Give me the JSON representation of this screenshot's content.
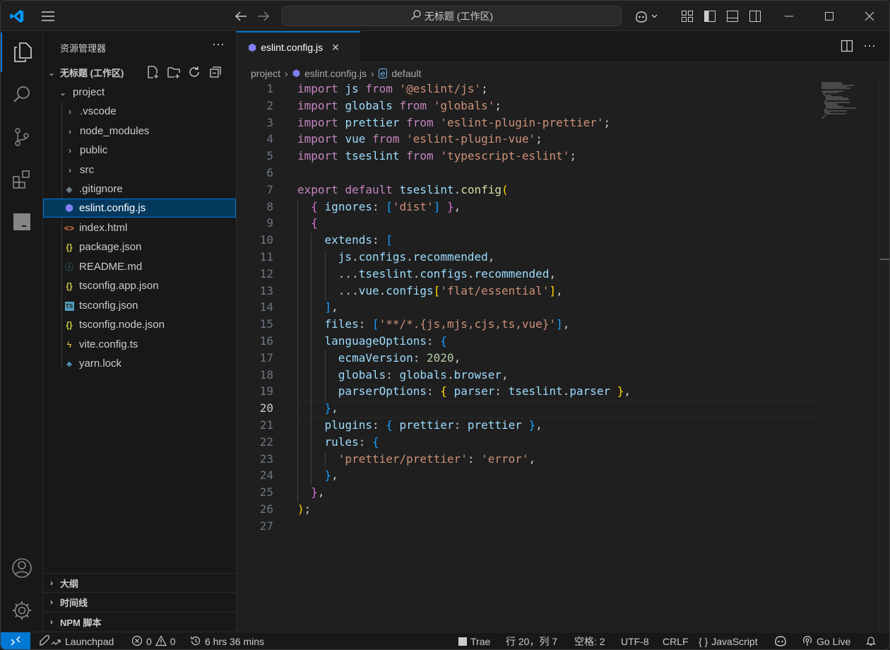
{
  "title_bar": {
    "search_text": "无标题 (工作区)"
  },
  "sidebar": {
    "header": "资源管理器",
    "workspace": "无标题 (工作区)",
    "tree": [
      {
        "label": "project",
        "icon": "chevron-down",
        "kind": "folder-open"
      },
      {
        "label": ".vscode",
        "icon": "chevron-right",
        "kind": "folder"
      },
      {
        "label": "node_modules",
        "icon": "chevron-right",
        "kind": "folder"
      },
      {
        "label": "public",
        "icon": "chevron-right",
        "kind": "folder"
      },
      {
        "label": "src",
        "icon": "chevron-right",
        "kind": "folder"
      },
      {
        "label": ".gitignore",
        "icon": "git-file-icon",
        "kind": "file"
      },
      {
        "label": "eslint.config.js",
        "icon": "eslint-file-icon",
        "kind": "file",
        "selected": true
      },
      {
        "label": "index.html",
        "icon": "html-file-icon",
        "kind": "file"
      },
      {
        "label": "package.json",
        "icon": "json-file-icon",
        "kind": "file"
      },
      {
        "label": "README.md",
        "icon": "info-file-icon",
        "kind": "file"
      },
      {
        "label": "tsconfig.app.json",
        "icon": "json-file-icon",
        "kind": "file"
      },
      {
        "label": "tsconfig.json",
        "icon": "ts-file-icon",
        "kind": "file"
      },
      {
        "label": "tsconfig.node.json",
        "icon": "json-file-icon",
        "kind": "file"
      },
      {
        "label": "vite.config.ts",
        "icon": "vite-file-icon",
        "kind": "file"
      },
      {
        "label": "yarn.lock",
        "icon": "yarn-file-icon",
        "kind": "file"
      }
    ],
    "panels": [
      "大纲",
      "时间线",
      "NPM 脚本"
    ]
  },
  "editor": {
    "tab_label": "eslint.config.js",
    "breadcrumb": [
      "project",
      "eslint.config.js",
      "default"
    ],
    "current_line": 20,
    "lines": [
      [
        [
          "kw",
          "import"
        ],
        [
          "p",
          " "
        ],
        [
          "id",
          "js"
        ],
        [
          "p",
          " "
        ],
        [
          "kw",
          "from"
        ],
        [
          "p",
          " "
        ],
        [
          "str",
          "'@eslint/js'"
        ],
        [
          "p",
          ";"
        ]
      ],
      [
        [
          "kw",
          "import"
        ],
        [
          "p",
          " "
        ],
        [
          "id",
          "globals"
        ],
        [
          "p",
          " "
        ],
        [
          "kw",
          "from"
        ],
        [
          "p",
          " "
        ],
        [
          "str",
          "'globals'"
        ],
        [
          "p",
          ";"
        ]
      ],
      [
        [
          "kw",
          "import"
        ],
        [
          "p",
          " "
        ],
        [
          "id",
          "prettier"
        ],
        [
          "p",
          " "
        ],
        [
          "kw",
          "from"
        ],
        [
          "p",
          " "
        ],
        [
          "str",
          "'eslint-plugin-prettier'"
        ],
        [
          "p",
          ";"
        ]
      ],
      [
        [
          "kw",
          "import"
        ],
        [
          "p",
          " "
        ],
        [
          "id",
          "vue"
        ],
        [
          "p",
          " "
        ],
        [
          "kw",
          "from"
        ],
        [
          "p",
          " "
        ],
        [
          "str",
          "'eslint-plugin-vue'"
        ],
        [
          "p",
          ";"
        ]
      ],
      [
        [
          "kw",
          "import"
        ],
        [
          "p",
          " "
        ],
        [
          "id",
          "tseslint"
        ],
        [
          "p",
          " "
        ],
        [
          "kw",
          "from"
        ],
        [
          "p",
          " "
        ],
        [
          "str",
          "'typescript-eslint'"
        ],
        [
          "p",
          ";"
        ]
      ],
      [],
      [
        [
          "kw",
          "export"
        ],
        [
          "p",
          " "
        ],
        [
          "kw",
          "default"
        ],
        [
          "p",
          " "
        ],
        [
          "id",
          "tseslint"
        ],
        [
          "p",
          "."
        ],
        [
          "fn",
          "config"
        ],
        [
          "b1",
          "("
        ]
      ],
      [
        [
          "p",
          "  "
        ],
        [
          "b2",
          "{"
        ],
        [
          "p",
          " "
        ],
        [
          "id",
          "ignores"
        ],
        [
          "p",
          ": "
        ],
        [
          "b3",
          "["
        ],
        [
          "str",
          "'dist'"
        ],
        [
          "b3",
          "]"
        ],
        [
          "p",
          " "
        ],
        [
          "b2",
          "}"
        ],
        [
          "p",
          ","
        ]
      ],
      [
        [
          "p",
          "  "
        ],
        [
          "b2",
          "{"
        ]
      ],
      [
        [
          "p",
          "    "
        ],
        [
          "id",
          "extends"
        ],
        [
          "p",
          ": "
        ],
        [
          "b3",
          "["
        ]
      ],
      [
        [
          "p",
          "      "
        ],
        [
          "id",
          "js"
        ],
        [
          "p",
          "."
        ],
        [
          "id",
          "configs"
        ],
        [
          "p",
          "."
        ],
        [
          "id",
          "recommended"
        ],
        [
          "p",
          ","
        ]
      ],
      [
        [
          "p",
          "      ..."
        ],
        [
          "id",
          "tseslint"
        ],
        [
          "p",
          "."
        ],
        [
          "id",
          "configs"
        ],
        [
          "p",
          "."
        ],
        [
          "id",
          "recommended"
        ],
        [
          "p",
          ","
        ]
      ],
      [
        [
          "p",
          "      ..."
        ],
        [
          "id",
          "vue"
        ],
        [
          "p",
          "."
        ],
        [
          "id",
          "configs"
        ],
        [
          "b1",
          "["
        ],
        [
          "str",
          "'flat/essential'"
        ],
        [
          "b1",
          "]"
        ],
        [
          "p",
          ","
        ]
      ],
      [
        [
          "p",
          "    "
        ],
        [
          "b3",
          "]"
        ],
        [
          "p",
          ","
        ]
      ],
      [
        [
          "p",
          "    "
        ],
        [
          "id",
          "files"
        ],
        [
          "p",
          ": "
        ],
        [
          "b3",
          "["
        ],
        [
          "str",
          "'**/*.{js,mjs,cjs,ts,vue}'"
        ],
        [
          "b3",
          "]"
        ],
        [
          "p",
          ","
        ]
      ],
      [
        [
          "p",
          "    "
        ],
        [
          "id",
          "languageOptions"
        ],
        [
          "p",
          ": "
        ],
        [
          "b3",
          "{"
        ]
      ],
      [
        [
          "p",
          "      "
        ],
        [
          "id",
          "ecmaVersion"
        ],
        [
          "p",
          ": "
        ],
        [
          "num",
          "2020"
        ],
        [
          "p",
          ","
        ]
      ],
      [
        [
          "p",
          "      "
        ],
        [
          "id",
          "globals"
        ],
        [
          "p",
          ": "
        ],
        [
          "id",
          "globals"
        ],
        [
          "p",
          "."
        ],
        [
          "id",
          "browser"
        ],
        [
          "p",
          ","
        ]
      ],
      [
        [
          "p",
          "      "
        ],
        [
          "id",
          "parserOptions"
        ],
        [
          "p",
          ": "
        ],
        [
          "b1",
          "{"
        ],
        [
          "p",
          " "
        ],
        [
          "id",
          "parser"
        ],
        [
          "p",
          ": "
        ],
        [
          "id",
          "tseslint"
        ],
        [
          "p",
          "."
        ],
        [
          "id",
          "parser"
        ],
        [
          "p",
          " "
        ],
        [
          "b1",
          "}"
        ],
        [
          "p",
          ","
        ]
      ],
      [
        [
          "p",
          "    "
        ],
        [
          "b3",
          "}"
        ],
        [
          "p",
          ","
        ]
      ],
      [
        [
          "p",
          "    "
        ],
        [
          "id",
          "plugins"
        ],
        [
          "p",
          ": "
        ],
        [
          "b3",
          "{"
        ],
        [
          "p",
          " "
        ],
        [
          "id",
          "prettier"
        ],
        [
          "p",
          ": "
        ],
        [
          "id",
          "prettier"
        ],
        [
          "p",
          " "
        ],
        [
          "b3",
          "}"
        ],
        [
          "p",
          ","
        ]
      ],
      [
        [
          "p",
          "    "
        ],
        [
          "id",
          "rules"
        ],
        [
          "p",
          ": "
        ],
        [
          "b3",
          "{"
        ]
      ],
      [
        [
          "p",
          "      "
        ],
        [
          "str",
          "'prettier/prettier'"
        ],
        [
          "p",
          ": "
        ],
        [
          "str",
          "'error'"
        ],
        [
          "p",
          ","
        ]
      ],
      [
        [
          "p",
          "    "
        ],
        [
          "b3",
          "}"
        ],
        [
          "p",
          ","
        ]
      ],
      [
        [
          "p",
          "  "
        ],
        [
          "b2",
          "}"
        ],
        [
          "p",
          ","
        ]
      ],
      [
        [
          "b1",
          ")"
        ],
        [
          "p",
          ";"
        ]
      ],
      []
    ]
  },
  "status_bar": {
    "launchpad": "Launchpad",
    "errors": "0",
    "warnings": "0",
    "time": "6 hrs 36 mins",
    "trae": "Trae",
    "position": "行 20，列 7",
    "spaces": "空格: 2",
    "encoding": "UTF-8",
    "eol": "CRLF",
    "language": "JavaScript",
    "golive": "Go Live"
  },
  "colors": {
    "accent": "#0078d4",
    "selection": "#04395e",
    "keyword": "#c586c0",
    "identifier": "#9cdcfe",
    "string": "#ce9178",
    "function": "#dcdcaa",
    "number": "#b5cea8"
  }
}
